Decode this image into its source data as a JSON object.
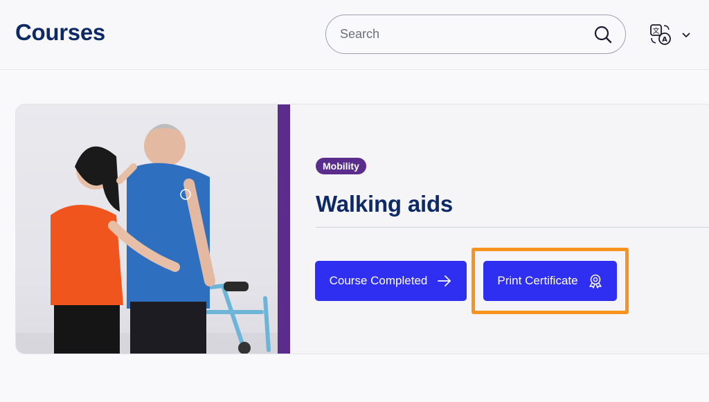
{
  "header": {
    "title": "Courses",
    "search": {
      "placeholder": "Search",
      "value": ""
    },
    "language_icon": "translate-icon",
    "dropdown_icon": "chevron-down-icon"
  },
  "course": {
    "category": "Mobility",
    "title": "Walking aids",
    "image_alt": "Health worker assisting older man using a walker",
    "completed_label": "Course Completed",
    "completed_icon": "arrow-right-icon",
    "print_label": "Print Certificate",
    "print_icon": "certificate-award-icon"
  },
  "colors": {
    "brand_navy": "#0e2a66",
    "accent_purple": "#5a2d8c",
    "button_blue": "#2f2ff2",
    "highlight_orange": "#f7931e"
  }
}
